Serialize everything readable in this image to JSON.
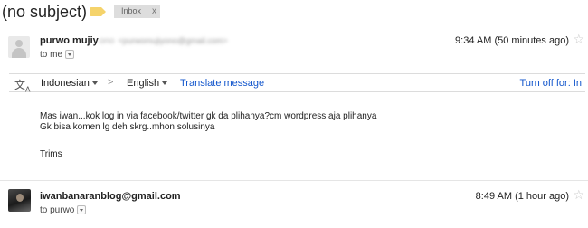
{
  "thread": {
    "subject": "(no subject)",
    "label_chip": "Inbox",
    "label_chip_close": "x"
  },
  "message1": {
    "sender_name_visible": "purwo mujiy",
    "sender_name_blurred": "ono",
    "sender_email_blurred": "<purwomujiyono@gmail.com>",
    "timestamp": "9:34 AM (50 minutes ago)",
    "recipient_line": "to me",
    "star_icon": "☆",
    "translate": {
      "source_language": "Indonesian",
      "arrow": ">",
      "target_language": "English",
      "translate_link": "Translate message",
      "turn_off_link": "Turn off for: In"
    },
    "body_lines": [
      "Mas iwan...kok log in via facebook/twitter gk da plihanya?cm wordpress aja plihanya",
      "Gk bisa komen lg deh skrg..mhon solusinya",
      "Trims"
    ]
  },
  "message2": {
    "sender": "iwanbanaranblog@gmail.com",
    "timestamp": "8:49 AM (1 hour ago)",
    "recipient_line": "to purwo",
    "star_icon": "☆"
  },
  "colors": {
    "link": "#1155cc",
    "label_tag": "#f5d36b",
    "chip_bg": "#dddddd"
  }
}
